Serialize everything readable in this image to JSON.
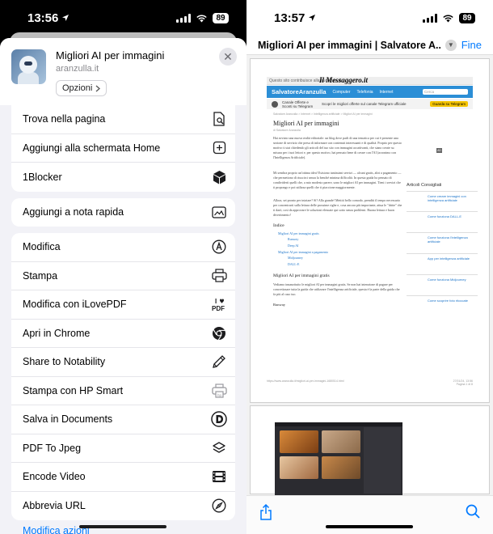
{
  "left": {
    "status": {
      "time": "13:56",
      "battery": "89"
    },
    "header": {
      "title": "Migliori AI per immagini",
      "url": "aranzulla.it",
      "options_label": "Opzioni"
    },
    "actions": [
      {
        "label": "Trova nella pagina",
        "icon": "find-in-page-icon"
      },
      {
        "label": "Aggiungi alla schermata Home",
        "icon": "add-square-icon"
      },
      {
        "label": "1Blocker",
        "icon": "cube-icon"
      },
      {
        "label": "Aggiungi a nota rapida",
        "icon": "quick-note-icon"
      },
      {
        "label": "Modifica",
        "icon": "markup-pen-icon"
      },
      {
        "label": "Stampa",
        "icon": "printer-icon"
      },
      {
        "label": "Modifica con iLovePDF",
        "icon": "ilovepdf-icon"
      },
      {
        "label": "Apri in Chrome",
        "icon": "chrome-icon"
      },
      {
        "label": "Share to Notability",
        "icon": "pencil-icon"
      },
      {
        "label": "Stampa con HP Smart",
        "icon": "hp-printer-icon"
      },
      {
        "label": "Salva in Documents",
        "icon": "documents-d-icon"
      },
      {
        "label": "PDF To Jpeg",
        "icon": "layers-icon"
      },
      {
        "label": "Encode Video",
        "icon": "film-icon"
      },
      {
        "label": "Abbrevia URL",
        "icon": "compass-icon"
      }
    ],
    "edit_actions_label": "Modifica azioni"
  },
  "right": {
    "status": {
      "time": "13:57",
      "battery": "89"
    },
    "title": "Migliori AI per immagini | Salvatore A...",
    "done_label": "Fine",
    "preview": {
      "topbar_text": "Questo sito contribuisce alla audience di",
      "newspaper": "Il Messaggero.it",
      "brand": "SalvatoreAranzulla",
      "nav": [
        "Computer",
        "Telefonia",
        "Internet"
      ],
      "search_placeholder": "Cerca",
      "channel_text": "Canale Offerte e Sconti su Telegram",
      "promo_text": "Scopri le migliori offerte sul canale Telegram ufficiale",
      "promo_button": "Guarda su Telegram",
      "breadcrumb": "Salvatore Aranzulla > Internet > Intelligenza artificiale > Migliori AI per immagini",
      "heading": "Migliori AI per immagini",
      "author": "di Salvatore Aranzulla",
      "para1": "Hai avviato una nuova realtà editoriale: un blog dove parli di una tematica per cui è presente una sezione di servizio che presa di informare con contenuti interessanti e di qualità. Proprio per questo motivo ti stai chiedendo gli articoli del tuo sito con immagini accattivanti, che siano create su misura per i tuoi lettori e, per questo motivo, hai pensato bene di creare con l'AI (acronimo con l'Intelligenza Artificiale).",
      "para2": "Mi sembra proprio un'ottima idea! Esistono tantissimi servizi — alcuni gratis, altri a pagamento — che permettono di riuscirci senza la benché minima difficoltà. In questa guida ho pensato di condividerti quelli che, a mio modesto parere, sono le migliori AI per immagini. Tieni i servizi che ti propongo e poi utilizza quelli che ti piaccione maggiormente.",
      "para3": "Allora, sei pronto per iniziare? Sì? Alla grande! Mettiti bello comodo, prenditi il tempo necessario per concentrarti sulla lettura delle prossime righe e, cosa ancora più importante, attua le \"dritte\" che ti darò, così da approvare le soluzioni elencate qui sotto senza problemi. Buona lettura e buon divertimento!",
      "index_title": "Indice",
      "index": [
        "Migliori AI per immagini gratis",
        "Runway",
        "Deep AI",
        "Migliori AI per immagini a pagamento",
        "Midjourney",
        "DALL-E"
      ],
      "section_title": "Migliori AI per immagini gratis",
      "para4": "Vediamo innanzitutto le migliori AI per immagini gratis. Se non hai intenzione di pagare per concretizzare tutta la guida che utilizzare l'intelligenza artificiale, questa è la parte della guida che fa più al caso tuo.",
      "sub_title": "Runway",
      "sidebar_title": "Articoli Consigliati",
      "sidebar": [
        "Come creare immagini con intelligenza artificiale",
        "Come funziona DALL-E",
        "Come funziona l'intelligenza artificiale",
        "App per intelligenza artificiale",
        "Come funziona Midjourney",
        "Come scoprire foto ritoccate"
      ],
      "ad_label": "AD",
      "footer_url": "https://www.aranzulla.it/migliori-ai-per-immagini-1680514.html",
      "footer_page": "27/01/24, 13:56 Pagina 1 di 8"
    }
  }
}
